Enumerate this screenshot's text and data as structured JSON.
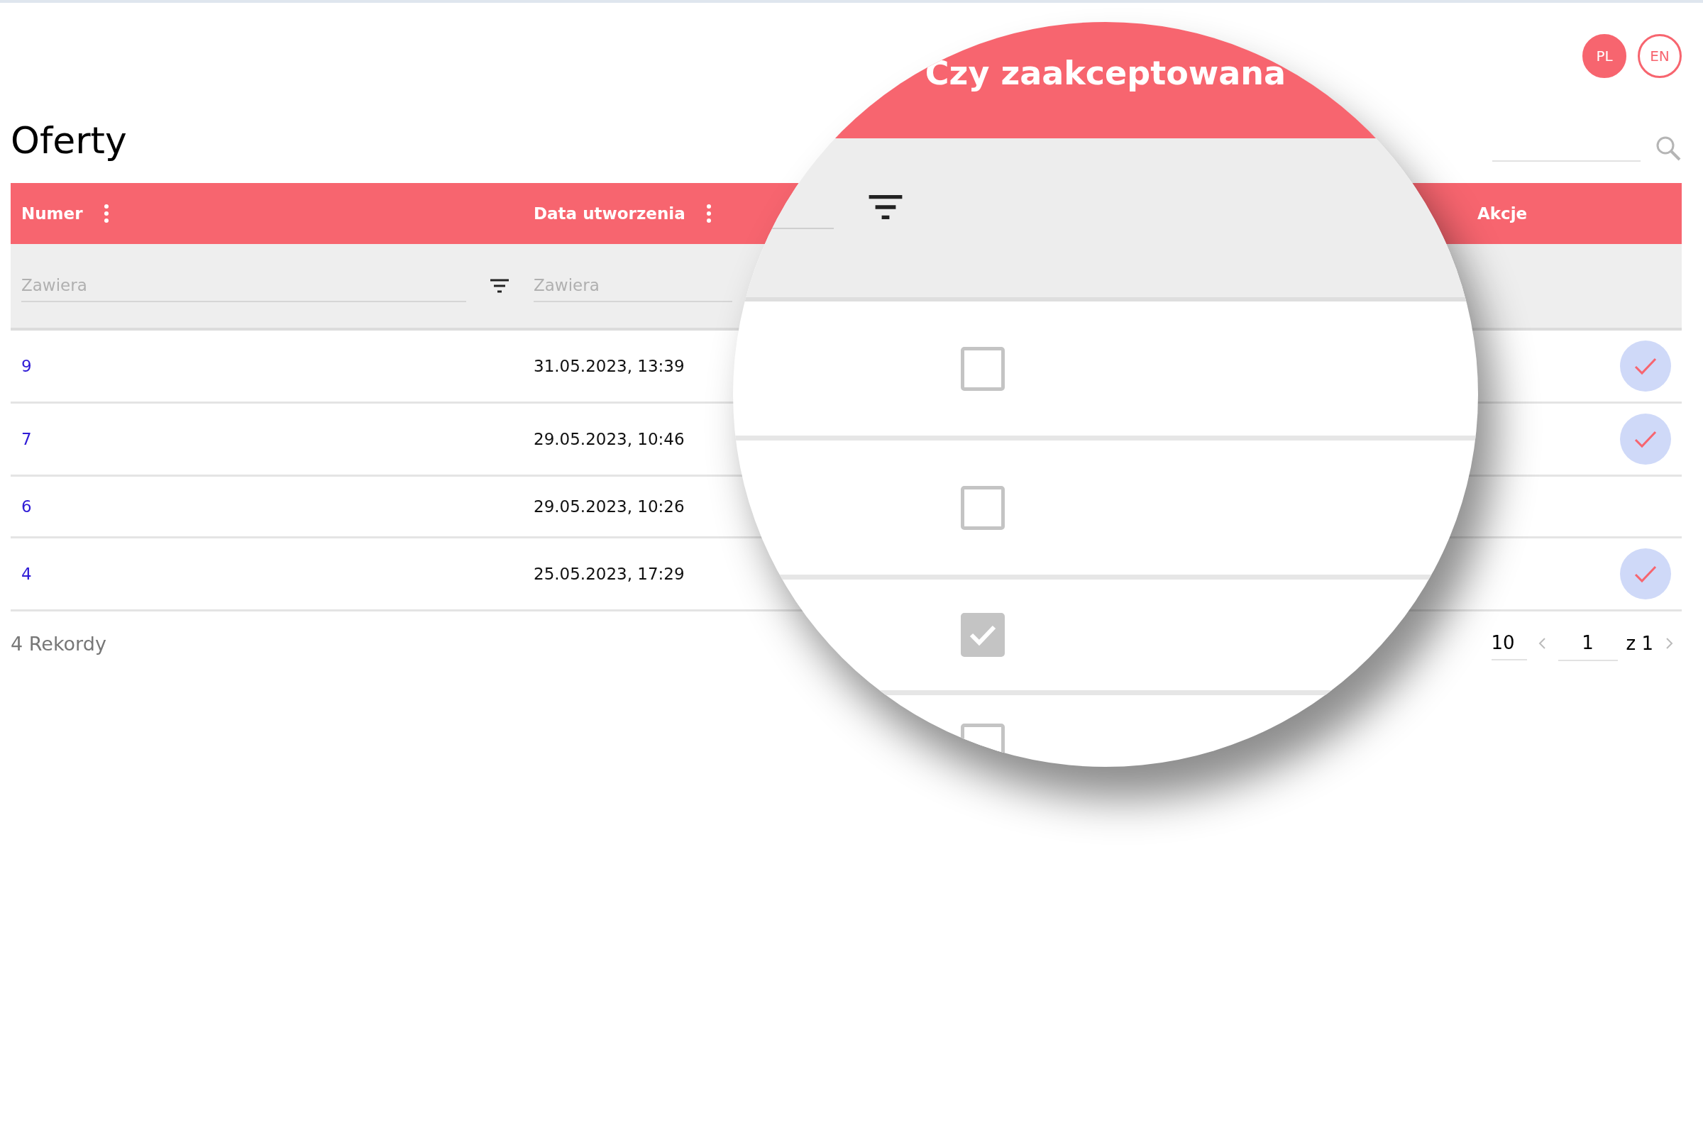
{
  "language_buttons": [
    {
      "label": "PL",
      "selected": true
    },
    {
      "label": "EN",
      "selected": false
    }
  ],
  "page": {
    "title": "Oferty"
  },
  "table": {
    "columns": [
      {
        "label": "Numer",
        "kind": "text",
        "menu": true,
        "filter_placeholder": "Zawiera",
        "filter_button": true
      },
      {
        "label": "Data utworzenia",
        "kind": "text",
        "menu": true,
        "filter_placeholder": "Zawiera",
        "filter_button": false
      },
      {
        "label": "Akcje",
        "kind": "actions",
        "menu": false,
        "filter_button": false
      }
    ],
    "rows": [
      {
        "number": "9",
        "created": "31.05.2023, 13:39",
        "accept_action": true
      },
      {
        "number": "7",
        "created": "29.05.2023, 10:46",
        "accept_action": true
      },
      {
        "number": "6",
        "created": "29.05.2023, 10:26",
        "accept_action": false
      },
      {
        "number": "4",
        "created": "25.05.2023, 17:29",
        "accept_action": true
      }
    ]
  },
  "footer": {
    "record_count": "4 Rekordy",
    "rows_per_page": "10",
    "page": "1",
    "page_total": "z 1"
  },
  "magnifier": {
    "column_title": "Czy zaakceptowana",
    "checkboxes": [
      {
        "checked": false
      },
      {
        "checked": false
      },
      {
        "checked": true
      },
      {
        "checked": false
      }
    ]
  }
}
